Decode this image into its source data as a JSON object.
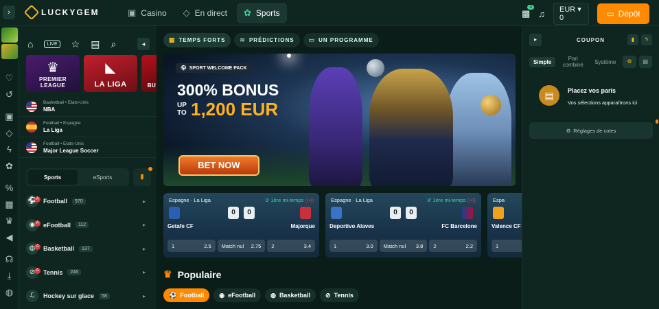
{
  "brand": {
    "name": "LUCKYGEM"
  },
  "nav": [
    {
      "label": "Casino",
      "icon": "cards-icon"
    },
    {
      "label": "En direct",
      "icon": "live-diamond-icon"
    },
    {
      "label": "Sports",
      "icon": "soccer-ball-icon",
      "active": true
    }
  ],
  "header": {
    "gift_badge": "4",
    "currency": "EUR",
    "balance": "0",
    "deposit_label": "Dépôt"
  },
  "sidebar": {
    "live_label": "LIVE",
    "leagues": [
      {
        "name": "PREMIER LEAGUE"
      },
      {
        "name": "LA LIGA"
      },
      {
        "name": "BU"
      }
    ],
    "top_leagues": [
      {
        "meta": "Basketball • Etats-Unis",
        "name": "NBA",
        "flag": "us"
      },
      {
        "meta": "Football • Espagne",
        "name": "La Liga",
        "flag": "es"
      },
      {
        "meta": "Football • Etats-Unis",
        "name": "Major League Soccer",
        "flag": "us"
      }
    ],
    "tabs": [
      {
        "label": "Sports",
        "active": true
      },
      {
        "label": "eSports"
      }
    ],
    "sports": [
      {
        "name": "Football",
        "count": "970",
        "live": "A"
      },
      {
        "name": "eFootball",
        "count": "112",
        "live": "A"
      },
      {
        "name": "Basketball",
        "count": "137",
        "live": "A"
      },
      {
        "name": "Tennis",
        "count": "246",
        "live": "A"
      },
      {
        "name": "Hockey sur glace",
        "count": "58"
      }
    ]
  },
  "main": {
    "pills": [
      {
        "label": "TEMPS FORTS",
        "active": true
      },
      {
        "label": "PRÉDICTIONS"
      },
      {
        "label": "UN PROGRAMME"
      }
    ],
    "banner": {
      "tag": "SPORT WELCOME PACK",
      "headline": "300% BONUS",
      "upto": "UP TO",
      "amount": "1,200 EUR",
      "cta": "BET NOW"
    },
    "matches": [
      {
        "league": "Espagne · La Liga",
        "time": "9' 1ère mi-temps",
        "home": "Getafe CF",
        "away": "Majorque",
        "score_home": "0",
        "score_away": "0",
        "odds": [
          {
            "label": "1",
            "value": "2.5"
          },
          {
            "label": "Match nul",
            "value": "2.75"
          },
          {
            "label": "2",
            "value": "3.4"
          }
        ]
      },
      {
        "league": "Espagne · La Liga",
        "time": "8' 1ère mi-temps",
        "home": "Deportivo Alaves",
        "away": "FC Barcelone",
        "score_home": "0",
        "score_away": "0",
        "odds": [
          {
            "label": "1",
            "value": "3.0"
          },
          {
            "label": "Match nul",
            "value": "3.8"
          },
          {
            "label": "2",
            "value": "2.2"
          }
        ]
      },
      {
        "league": "Espa",
        "time": "",
        "home": "Valence CF",
        "away": "",
        "score_home": "",
        "score_away": "",
        "odds": [
          {
            "label": "1",
            "value": ""
          }
        ]
      }
    ],
    "popular": {
      "title": "Populaire",
      "chips": [
        {
          "label": "Football",
          "active": true
        },
        {
          "label": "eFootball"
        },
        {
          "label": "Basketball"
        },
        {
          "label": "Tennis"
        }
      ]
    }
  },
  "coupon": {
    "title": "COUPON",
    "tabs": [
      {
        "label": "Simple",
        "active": true
      },
      {
        "label": "Pari combiné"
      },
      {
        "label": "Système"
      }
    ],
    "empty_title": "Placez vos paris",
    "empty_sub": "Vos sélections apparaîtrons ici",
    "settings_label": "Réglages de cotes"
  },
  "colors": {
    "accent": "#ff8a00",
    "live_green": "#3fd39a",
    "background": "#0b1d18",
    "panel": "#0f2520"
  }
}
